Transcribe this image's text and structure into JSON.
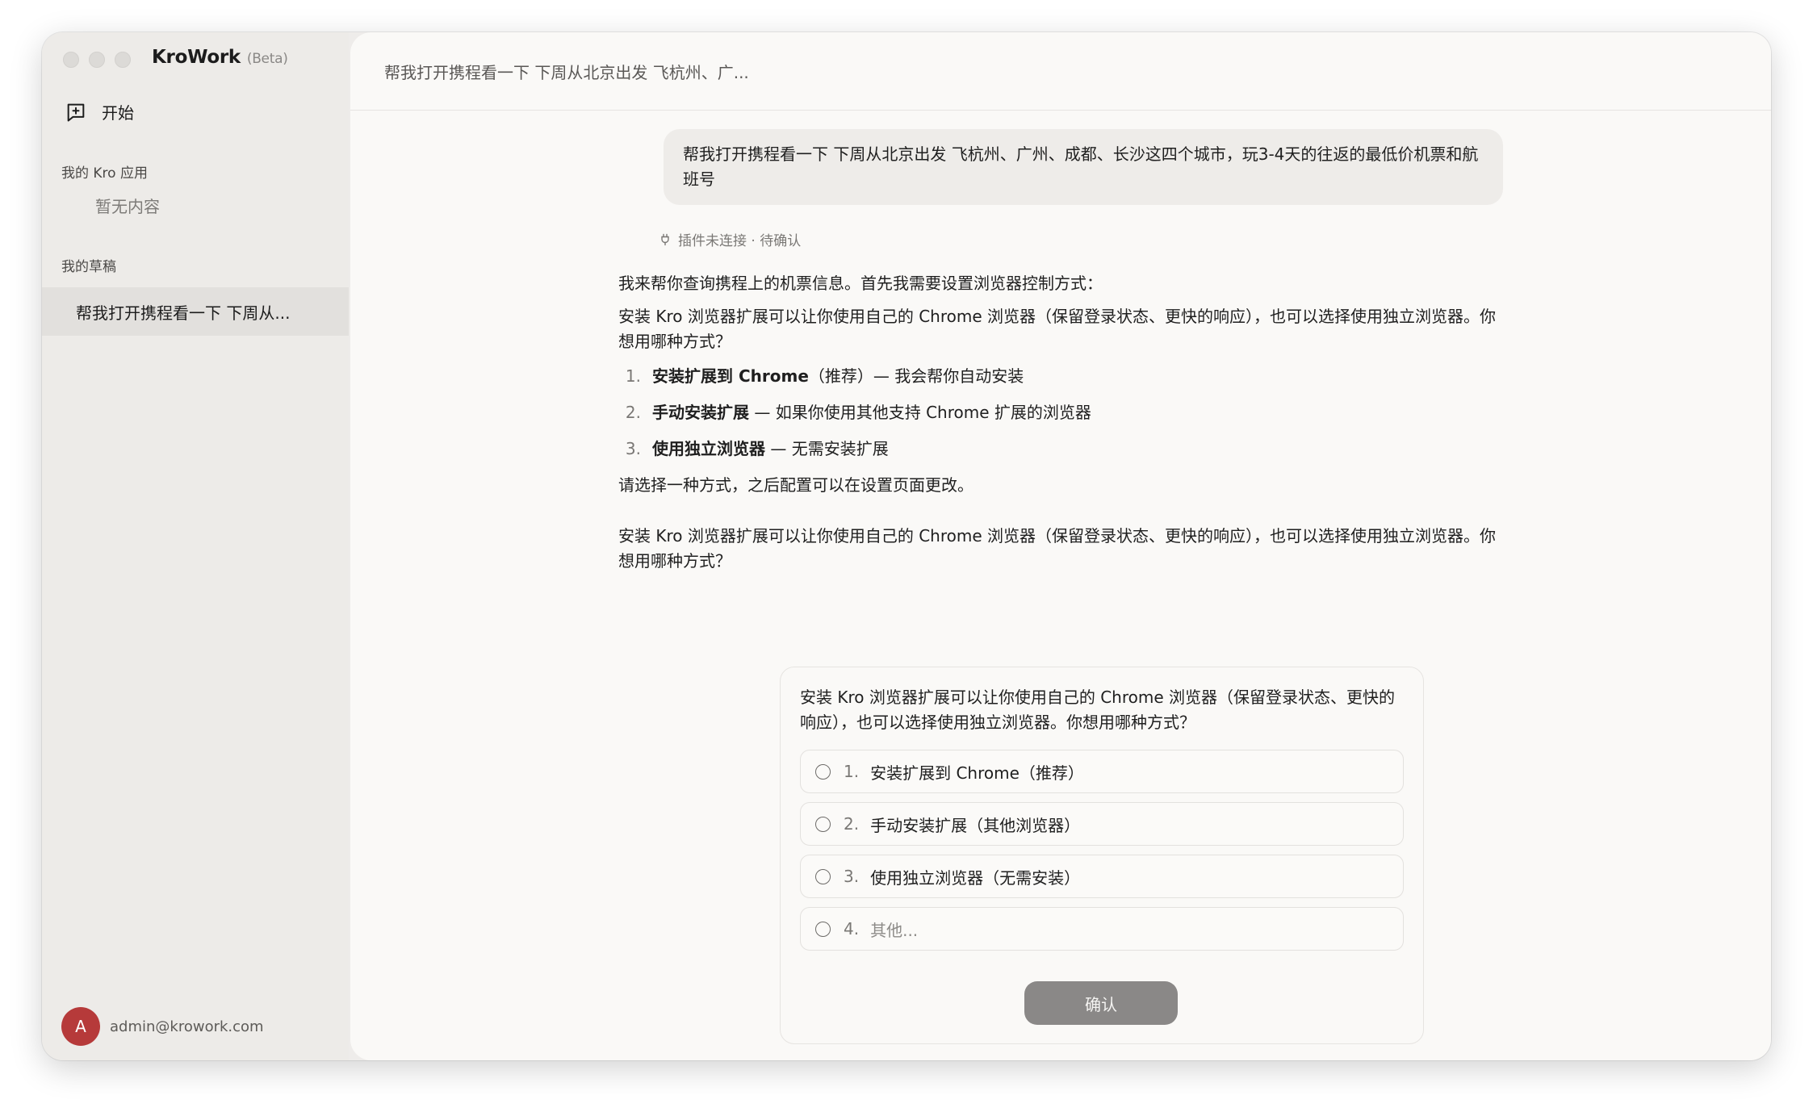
{
  "app": {
    "name": "KroWork",
    "badge": "(Beta)"
  },
  "sidebar": {
    "new_chat_label": "开始",
    "apps_section_title": "我的 Kro 应用",
    "apps_empty": "暂无内容",
    "drafts_section_title": "我的草稿",
    "drafts": [
      {
        "label": "帮我打开携程看一下 下周从..."
      }
    ],
    "user": {
      "avatar_letter": "A",
      "email": "admin@krowork.com"
    }
  },
  "header": {
    "title": "帮我打开携程看一下 下周从北京出发 飞杭州、广..."
  },
  "conversation": {
    "user_message": "帮我打开携程看一下 下周从北京出发 飞杭州、广州、成都、长沙这四个城市，玩3-4天的往返的最低价机票和航班号",
    "plugin_status": "插件未连接 · 待确认",
    "assistant": {
      "intro": "我来帮你查询携程上的机票信息。首先我需要设置浏览器控制方式：",
      "explain": "安装 Kro 浏览器扩展可以让你使用自己的 Chrome 浏览器（保留登录状态、更快的响应），也可以选择使用独立浏览器。你想用哪种方式？",
      "options": [
        {
          "num": "1.",
          "bold": "安装扩展到 Chrome",
          "rest": "（推荐）— 我会帮你自动安装"
        },
        {
          "num": "2.",
          "bold": "手动安装扩展",
          "rest": " — 如果你使用其他支持 Chrome 扩展的浏览器"
        },
        {
          "num": "3.",
          "bold": "使用独立浏览器",
          "rest": " — 无需安装扩展"
        }
      ],
      "closing": "请选择一种方式，之后配置可以在设置页面更改。",
      "repeat": "安装 Kro 浏览器扩展可以让你使用自己的 Chrome 浏览器（保留登录状态、更快的响应），也可以选择使用独立浏览器。你想用哪种方式？"
    }
  },
  "question_card": {
    "text": "安装 Kro 浏览器扩展可以让你使用自己的 Chrome 浏览器（保留登录状态、更快的响应），也可以选择使用独立浏览器。你想用哪种方式？",
    "options": [
      {
        "num": "1.",
        "label": "安装扩展到 Chrome（推荐）"
      },
      {
        "num": "2.",
        "label": "手动安装扩展（其他浏览器）"
      },
      {
        "num": "3.",
        "label": "使用独立浏览器（无需安装）"
      },
      {
        "num": "4.",
        "label": "其他..."
      }
    ],
    "confirm_label": "确认"
  },
  "colors": {
    "avatar": "#b63a3a",
    "confirm_button": "#8a8887",
    "sidebar_bg": "#edebe8",
    "main_bg": "#faf9f7"
  }
}
